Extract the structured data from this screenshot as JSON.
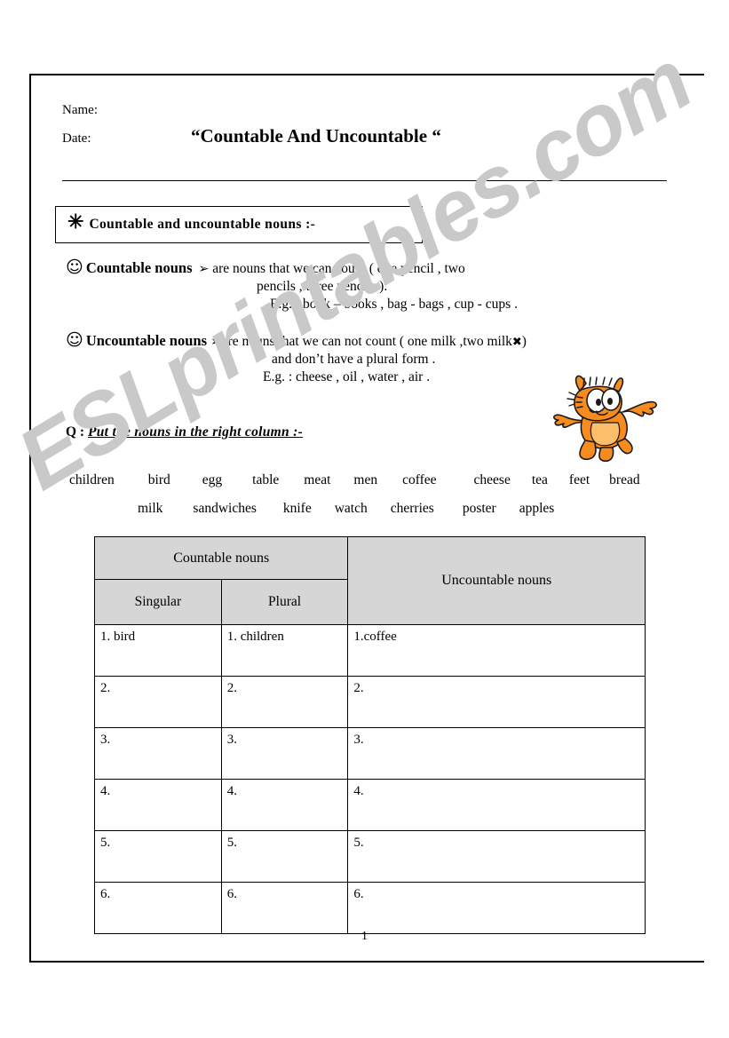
{
  "header": {
    "name_label": "Name:",
    "date_label": "Date:",
    "title": "“Countable And Uncountable “"
  },
  "section_heading": {
    "star": "✳",
    "label": "Countable and uncountable nouns :-"
  },
  "definitions": [
    {
      "icon": "smiley-face-icon",
      "smiley": "☺",
      "term": "Countable nouns",
      "bullet": "➢",
      "line1": "are nouns that we can count ( one pencil , two",
      "line2": "pencils , three pencils ).",
      "line3": "E.g. :  book – books   ,   bag  -  bags    ,   cup  -  cups  ."
    },
    {
      "icon": "smiley-face-icon",
      "smiley": "☺",
      "term": "Uncountable nouns",
      "bullet": "➢",
      "line1_a": "are nouns that we can not count ( one milk ,two milk",
      "line1_cross": "✖",
      "line1_b": ")",
      "line2": "and don’t have a plural form .",
      "line3": "E.g. :  cheese ,  oil  , water ,  air ."
    }
  ],
  "illustration": {
    "name": "garfield-cat-illustration",
    "colors": {
      "body": "#F68B1F",
      "belly": "#FBBE6B",
      "stripe": "#8B4A10",
      "outline": "#1A1A1A",
      "eye_white": "#FFFFFF"
    }
  },
  "question": {
    "prefix": "Q : ",
    "text": "Put the nouns in the right column :-"
  },
  "word_bank": {
    "row1": [
      "children",
      "bird",
      "egg",
      "table",
      "meat",
      "men",
      "coffee",
      "cheese",
      "tea",
      "feet",
      "bread"
    ],
    "row2": [
      "milk",
      "sandwiches",
      "knife",
      "watch",
      "cherries",
      "poster",
      "apples"
    ]
  },
  "table": {
    "header_countable": "Countable nouns",
    "header_uncountable": "Uncountable nouns",
    "subheader_singular": "Singular",
    "subheader_plural": "Plural",
    "header_bg": "#d6d6d6",
    "rows": [
      {
        "singular": "1. bird",
        "plural": "1. children",
        "uncountable": "1.coffee"
      },
      {
        "singular": "2.",
        "plural": "2.",
        "uncountable": "2."
      },
      {
        "singular": "3.",
        "plural": "3.",
        "uncountable": "3."
      },
      {
        "singular": "4.",
        "plural": "4.",
        "uncountable": "4."
      },
      {
        "singular": "5.",
        "plural": "5.",
        "uncountable": "5."
      },
      {
        "singular": "6.",
        "plural": "6.",
        "uncountable": "6."
      }
    ]
  },
  "watermark": {
    "text": "ESLprintables.com",
    "color": "#c9c9c9"
  },
  "footer": {
    "page_number": "1"
  }
}
